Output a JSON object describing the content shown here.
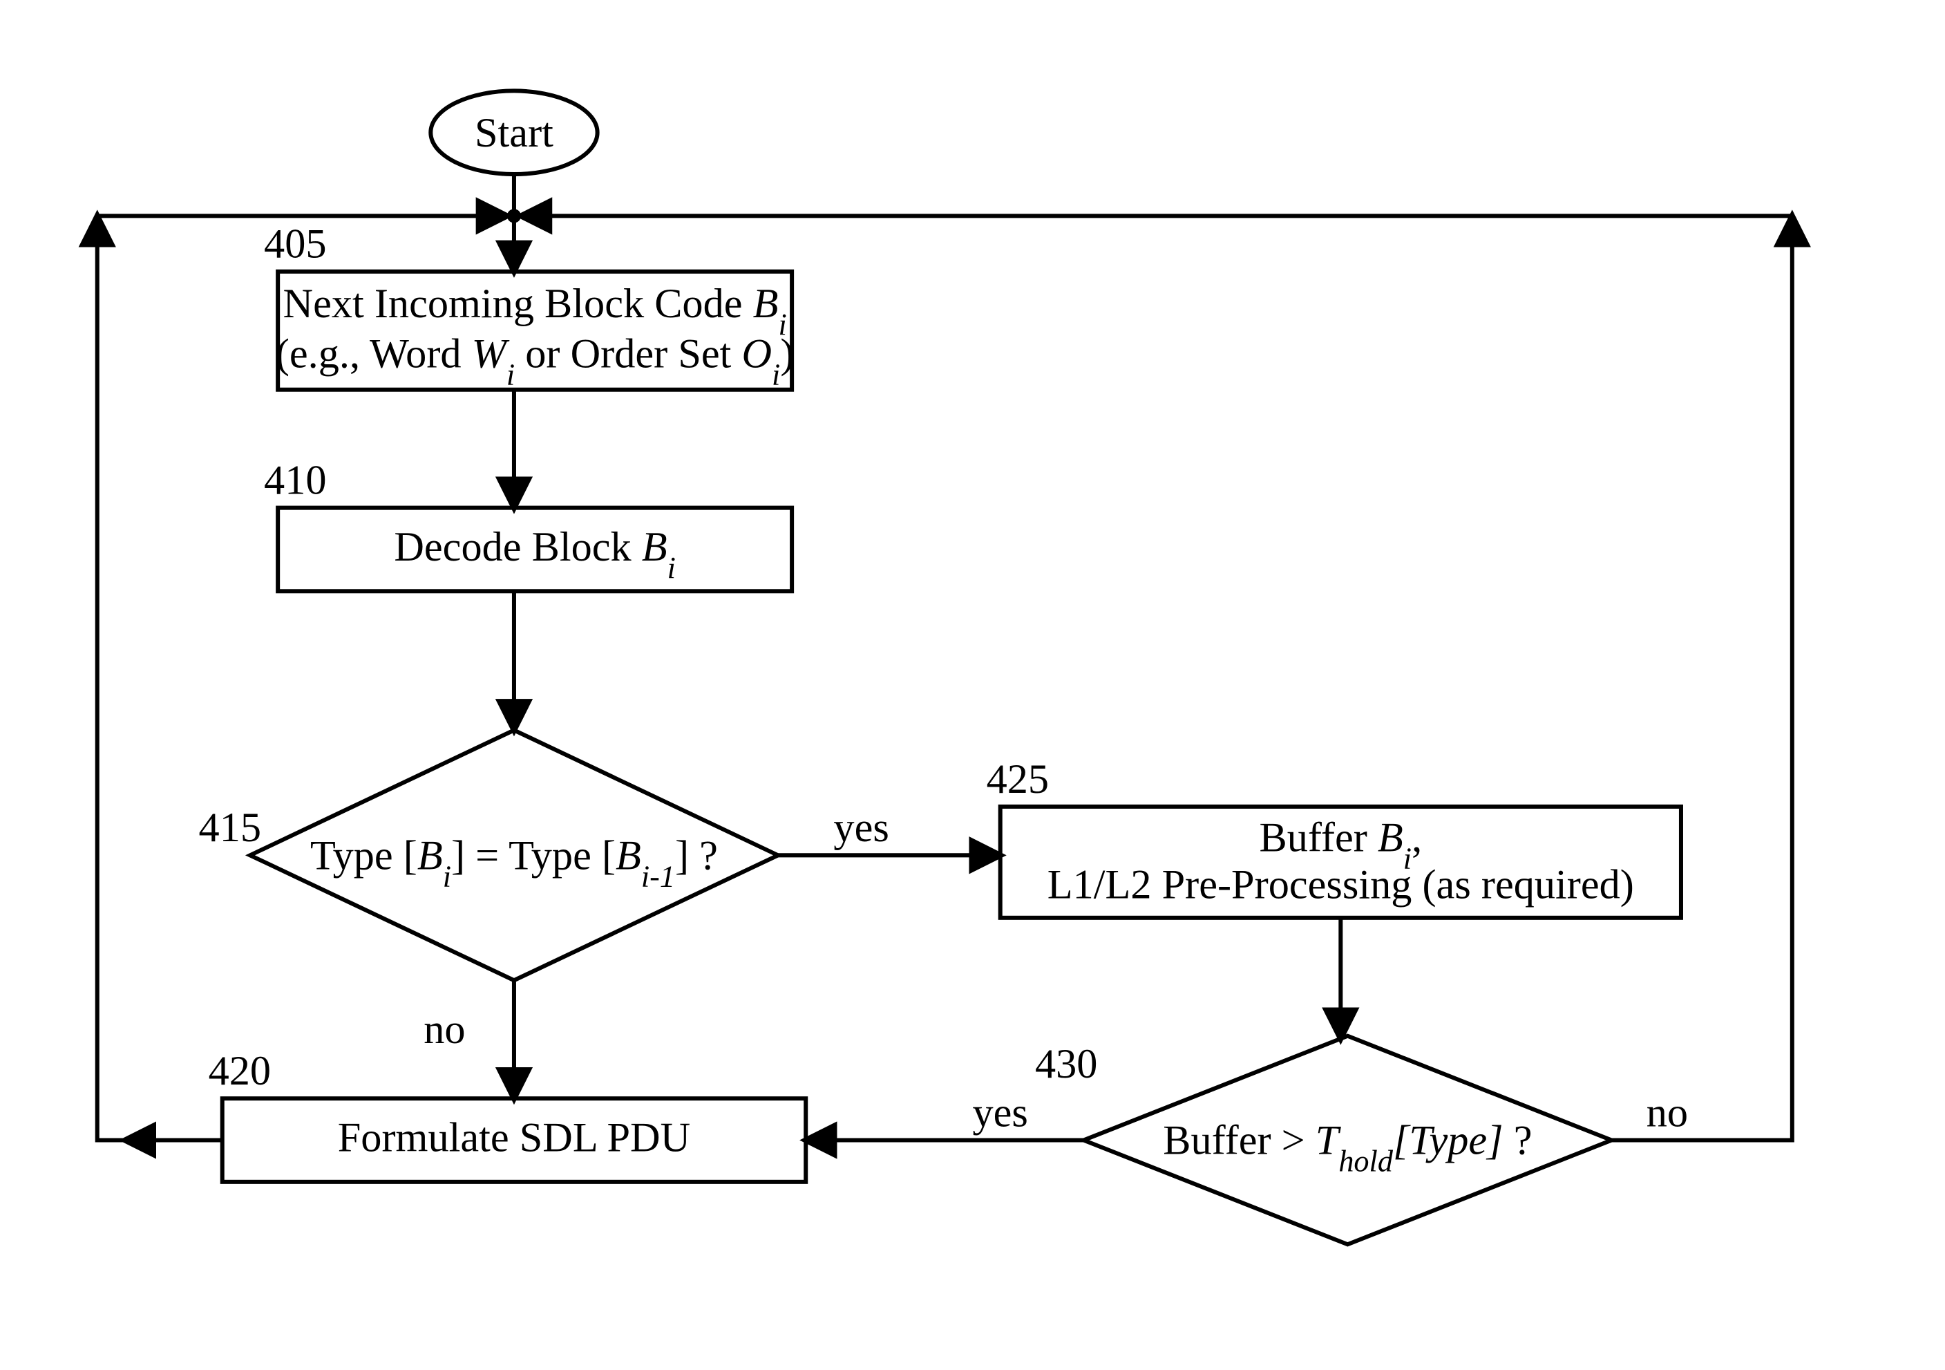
{
  "chart_data": {
    "type": "flowchart",
    "nodes": [
      {
        "id": "start",
        "kind": "terminator",
        "label": "Start"
      },
      {
        "id": "n405",
        "kind": "process",
        "ref": "405",
        "label_line1": "Next Incoming  Block Code ",
        "label_line1_italic": "B",
        "label_line1_sub": "i",
        "label_line2a": "(e.g.,  Word ",
        "label_line2b_italic": "W",
        "label_line2b_sub": "i",
        "label_line2c": " or Order Set ",
        "label_line2d_italic": "O",
        "label_line2d_sub": "i",
        "label_line2e": ")"
      },
      {
        "id": "n410",
        "kind": "process",
        "ref": "410",
        "label": "Decode Block ",
        "label_italic": "B",
        "label_sub": "i"
      },
      {
        "id": "n415",
        "kind": "decision",
        "ref": "415",
        "label_a": "Type [",
        "label_b_italic": "B",
        "label_b_sub": "i",
        "label_c": "] = Type [",
        "label_d_italic": "B",
        "label_d_sub": "i-1",
        "label_e": "] ?"
      },
      {
        "id": "n420",
        "kind": "process",
        "ref": "420",
        "label": "Formulate SDL PDU"
      },
      {
        "id": "n425",
        "kind": "process",
        "ref": "425",
        "label_line1a": "Buffer ",
        "label_line1b_italic": "B",
        "label_line1b_sub": "i",
        "label_line1c": ",",
        "label_line2": "L1/L2 Pre-Processing (as required)"
      },
      {
        "id": "n430",
        "kind": "decision",
        "ref": "430",
        "label_a": "Buffer > ",
        "label_b_italic": "T",
        "label_b_sub_italic": "hold",
        "label_c_italic": "[Type]",
        "label_d": " ?"
      }
    ],
    "edges": [
      {
        "from": "start",
        "to": "n405"
      },
      {
        "from": "n405",
        "to": "n410"
      },
      {
        "from": "n410",
        "to": "n415"
      },
      {
        "from": "n415",
        "to": "n425",
        "label": "yes"
      },
      {
        "from": "n415",
        "to": "n420",
        "label": "no"
      },
      {
        "from": "n420",
        "to": "start",
        "label": "",
        "kind": "loop-left"
      },
      {
        "from": "n425",
        "to": "n430"
      },
      {
        "from": "n430",
        "to": "n420",
        "label": "yes"
      },
      {
        "from": "n430",
        "to": "start",
        "label": "no",
        "kind": "loop-right"
      }
    ]
  }
}
